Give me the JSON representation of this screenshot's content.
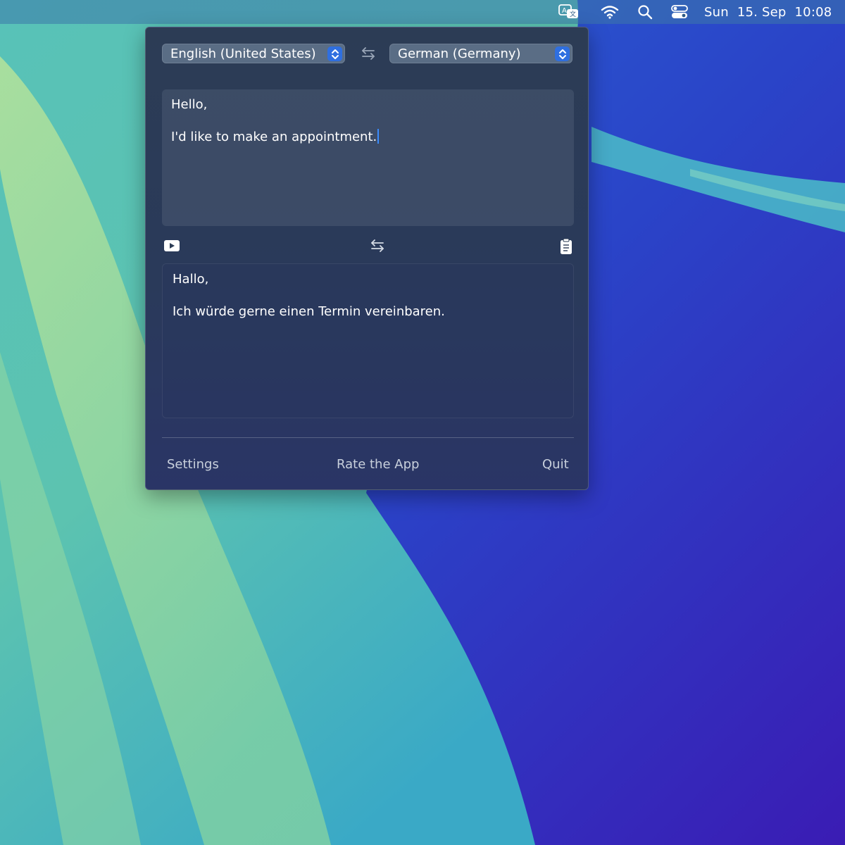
{
  "menubar": {
    "icons": [
      "translate-icon",
      "wifi-icon",
      "search-icon",
      "control-center-icon"
    ],
    "clock": {
      "day": "Sun",
      "date": "15. Sep",
      "time": "10:08"
    }
  },
  "translator": {
    "source_language": "English (United States)",
    "target_language": "German (Germany)",
    "source_text": {
      "line1": "Hello,",
      "line2": "I'd like to make an appointment."
    },
    "translated_text": {
      "line1": "Hallo,",
      "line2": "Ich würde gerne einen Termin vereinbaren."
    },
    "toolbar_icons": [
      "play-icon",
      "swap-icon",
      "clipboard-icon"
    ]
  },
  "footer": {
    "settings": "Settings",
    "rate": "Rate the App",
    "quit": "Quit"
  },
  "colors": {
    "accent": "#2f6fe0",
    "caret": "#3a8cff"
  }
}
